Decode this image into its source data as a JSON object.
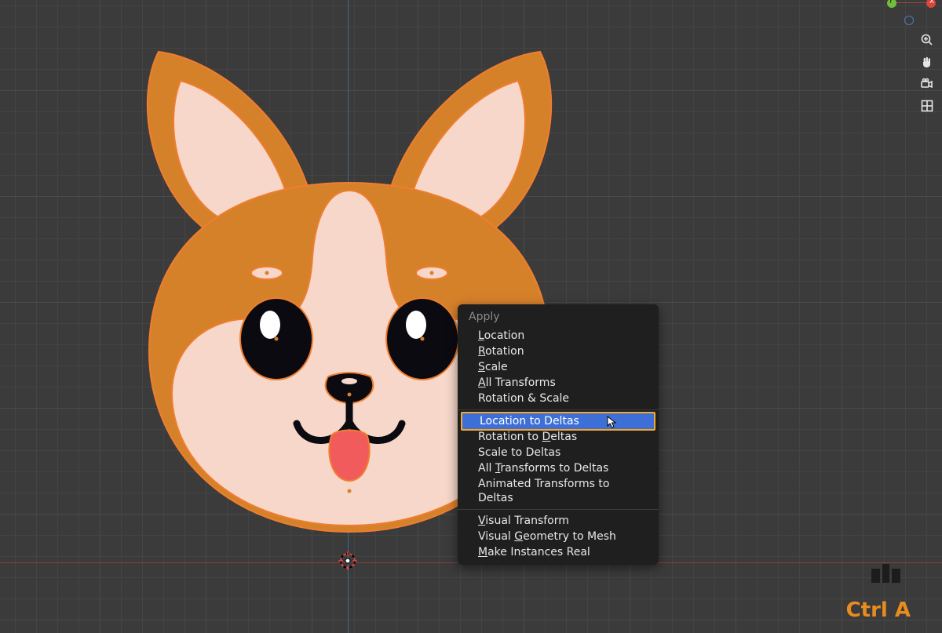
{
  "gizmo": {
    "x_label": "X",
    "y_label": "Y"
  },
  "side_tools": [
    "zoom",
    "pan",
    "camera",
    "grid"
  ],
  "menu": {
    "title": "Apply",
    "items": [
      {
        "label": "Location",
        "underline": 0
      },
      {
        "label": "Rotation",
        "underline": 0
      },
      {
        "label": "Scale",
        "underline": 0
      },
      {
        "label": "All Transforms",
        "underline": 0
      },
      {
        "label": "Rotation & Scale",
        "underline": -1
      },
      {
        "sep": true
      },
      {
        "label": "Location to Deltas",
        "underline": -1,
        "highlight": true
      },
      {
        "label": "Rotation to Deltas",
        "underline": 12
      },
      {
        "label": "Scale to Deltas",
        "underline": -1
      },
      {
        "label": "All Transforms to Deltas",
        "underline": 4
      },
      {
        "label": "Animated Transforms to Deltas",
        "underline": -1
      },
      {
        "sep": true
      },
      {
        "label": "Visual Transform",
        "underline": 0
      },
      {
        "label": "Visual Geometry to Mesh",
        "underline": 7
      },
      {
        "label": "Make Instances Real",
        "underline": 0
      }
    ]
  },
  "hotkey_hint": "Ctrl A",
  "colors": {
    "dog_fur": "#d5812a",
    "dog_skin": "#f6d7c9",
    "dog_tongue": "#f25b5b",
    "dog_outline_sel": "#f07d2f",
    "menu_highlight": "#3e6fd6",
    "highlight_border": "#f6a82e"
  }
}
